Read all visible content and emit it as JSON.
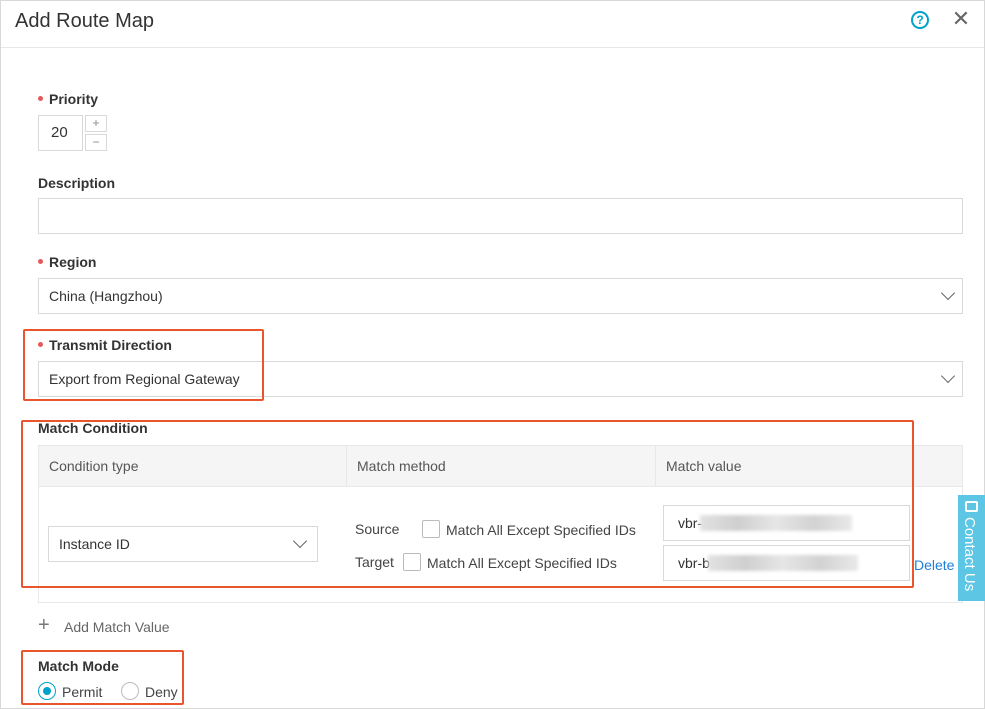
{
  "dialog": {
    "title": "Add Route Map",
    "help_glyph": "?",
    "close_glyph": "✕"
  },
  "priority": {
    "label": "Priority",
    "value": "20",
    "inc": "+",
    "dec": "−"
  },
  "description": {
    "label": "Description",
    "value": ""
  },
  "region": {
    "label": "Region",
    "value": "China (Hangzhou)"
  },
  "transmit": {
    "label": "Transmit Direction",
    "value": "Export from Regional Gateway"
  },
  "match_condition": {
    "label": "Match Condition",
    "columns": [
      "Condition type",
      "Match method",
      "Match value"
    ],
    "row": {
      "condition_type": "Instance ID",
      "source_label": "Source",
      "target_label": "Target",
      "except_label": "Match All Except Specified IDs",
      "source_value_prefix": "vbr-",
      "target_value_prefix": "vbr-b",
      "delete_label": "Delete"
    },
    "add_label": "Add Match Value"
  },
  "match_mode": {
    "label": "Match Mode",
    "options": [
      "Permit",
      "Deny"
    ],
    "selected": "Permit"
  },
  "contact": {
    "label": "Contact Us"
  },
  "colors": {
    "accent": "#00a2ca",
    "highlight": "#e8552f",
    "required": "#e45a5a",
    "link": "#1f7fd6"
  }
}
